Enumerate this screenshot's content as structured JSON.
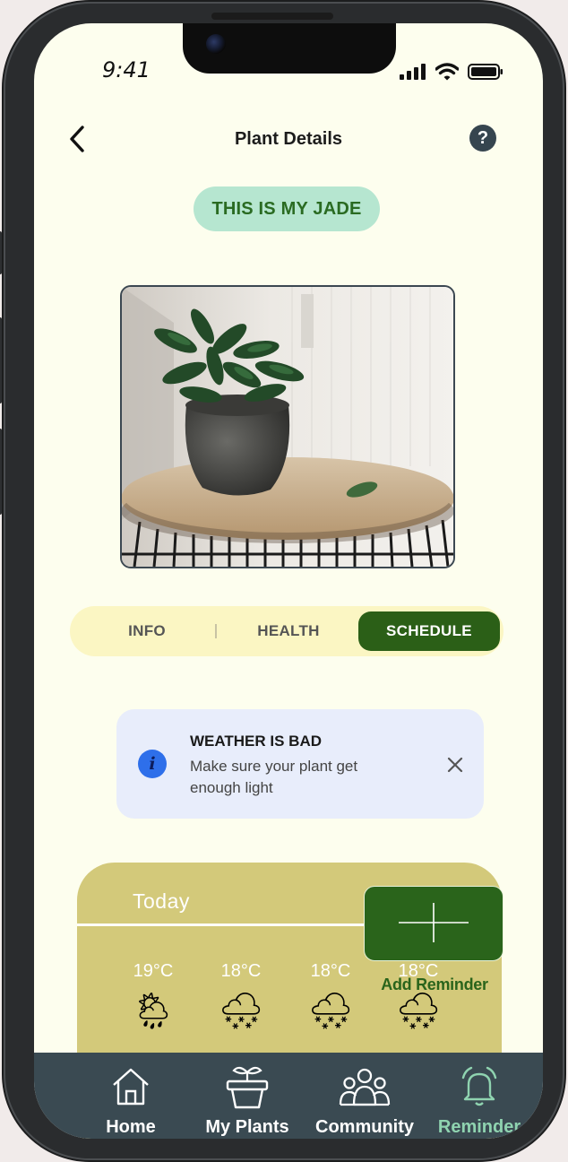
{
  "status_bar": {
    "time": "9:41"
  },
  "header": {
    "title": "Plant Details",
    "help_label": "?"
  },
  "plant": {
    "name_badge": "THIS IS MY JADE"
  },
  "tabs": [
    {
      "label": "INFO",
      "active": false
    },
    {
      "label": "HEALTH",
      "active": false
    },
    {
      "label": "SCHEDULE",
      "active": true
    }
  ],
  "alert": {
    "icon": "info-icon",
    "icon_glyph": "i",
    "title": "WEATHER IS BAD",
    "body": "Make sure your plant get enough light"
  },
  "weather": {
    "heading": "Today",
    "forecast": [
      {
        "temp": "19°C",
        "icon": "sun-rain-cloud-icon",
        "glyph": "🌦"
      },
      {
        "temp": "18°C",
        "icon": "night-snow-rain-cloud-icon",
        "glyph": "🌨"
      },
      {
        "temp": "18°C",
        "icon": "night-snow-rain-cloud-icon",
        "glyph": "🌨"
      },
      {
        "temp": "18°C",
        "icon": "night-snow-rain-cloud-icon",
        "glyph": "🌨"
      }
    ]
  },
  "add_reminder": {
    "label": "Add Reminder"
  },
  "nav": [
    {
      "label": "Home",
      "icon": "home-icon",
      "active": false
    },
    {
      "label": "My Plants",
      "icon": "plant-pot-icon",
      "active": false
    },
    {
      "label": "Community",
      "icon": "community-icon",
      "active": false
    },
    {
      "label": "Reminder",
      "icon": "bell-icon",
      "active": true
    }
  ],
  "colors": {
    "screen_bg": "#fdfeee",
    "accent_green": "#2b5f17",
    "badge_bg": "#b6e6d0",
    "navbar_bg": "#3a4a52",
    "weather_card": "#d3c97a",
    "alert_bg": "#e8edfb",
    "nav_active": "#8fd3b0"
  }
}
